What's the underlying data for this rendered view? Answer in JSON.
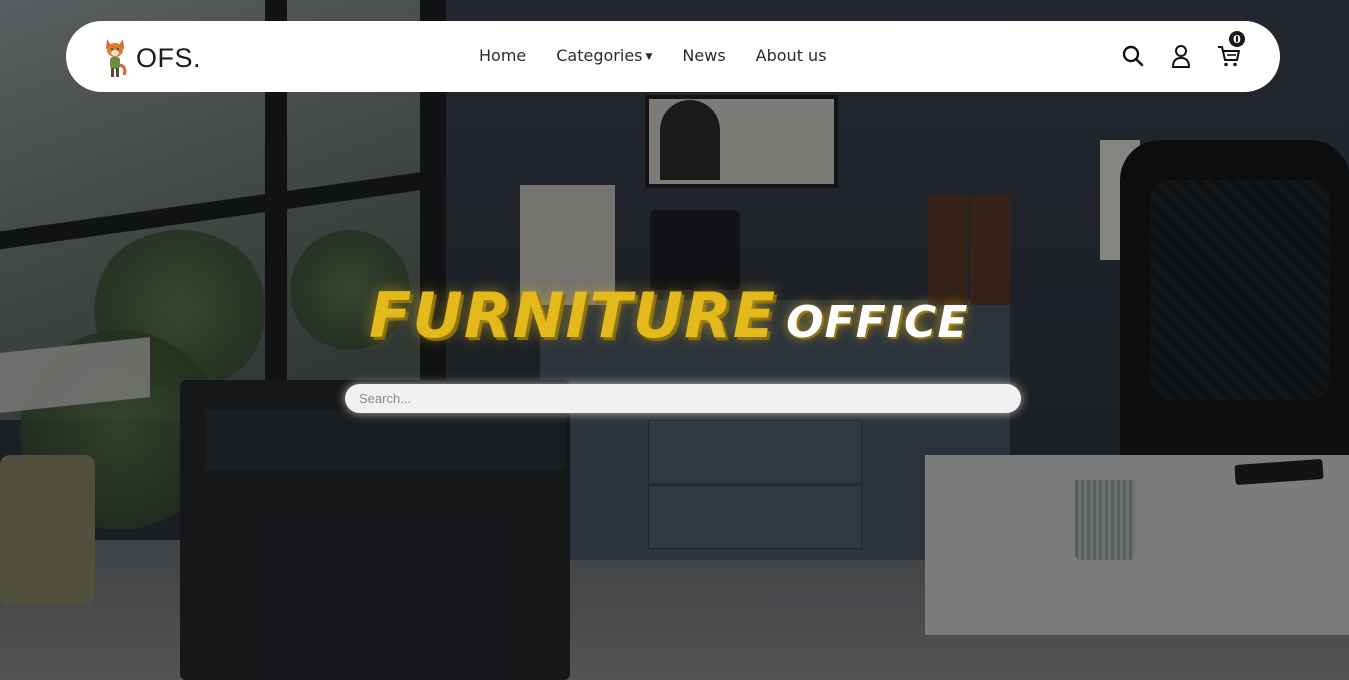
{
  "brand": {
    "name": "OFS.",
    "logo_icon": "fox-logo-icon"
  },
  "nav": {
    "items": [
      {
        "label": "Home"
      },
      {
        "label": "Categories",
        "has_dropdown": true
      },
      {
        "label": "News"
      },
      {
        "label": "About us"
      }
    ]
  },
  "header_icons": {
    "search": "search-icon",
    "account": "user-icon",
    "cart": "cart-icon",
    "cart_count": "0"
  },
  "hero": {
    "title_part1": "FURNITURE",
    "title_part2": "OFFICE",
    "search_placeholder": "Search..."
  },
  "colors": {
    "accent": "#e4b91c",
    "navbar_bg": "#ffffff",
    "text_dark": "#2b2b2b"
  }
}
